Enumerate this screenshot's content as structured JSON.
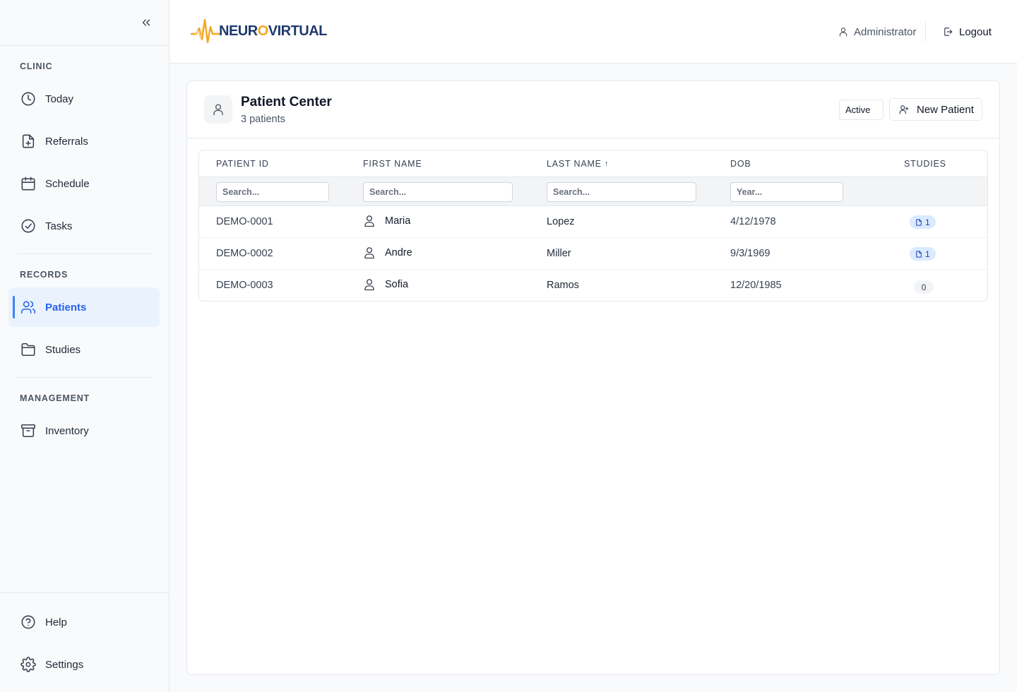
{
  "sidebar": {
    "sections": {
      "clinic": "CLINIC",
      "records": "RECORDS",
      "management": "MANAGEMENT"
    },
    "items": {
      "today": "Today",
      "referrals": "Referrals",
      "schedule": "Schedule",
      "tasks": "Tasks",
      "patients": "Patients",
      "studies": "Studies",
      "inventory": "Inventory",
      "help": "Help",
      "settings": "Settings"
    },
    "active": "Patients"
  },
  "header": {
    "logo_part1": "NEUR",
    "logo_o": "O",
    "logo_part2": "VIRTUAL",
    "user": "Administrator",
    "logout": "Logout"
  },
  "patient_center": {
    "title": "Patient Center",
    "subtitle": "3 patients",
    "status_filter": "Active",
    "new_patient": "New Patient"
  },
  "table": {
    "columns": {
      "patient_id": "PATIENT ID",
      "first_name": "FIRST NAME",
      "last_name": "LAST NAME",
      "last_name_sort": "↑",
      "dob": "DOB",
      "studies": "STUDIES"
    },
    "filters": {
      "patient_id": "Search...",
      "first_name": "Search...",
      "last_name": "Search...",
      "dob": "Year..."
    },
    "rows": [
      {
        "id": "DEMO-0001",
        "first": "Maria",
        "last": "Lopez",
        "dob": "4/12/1978",
        "studies": "1"
      },
      {
        "id": "DEMO-0002",
        "first": "Andre",
        "last": "Miller",
        "dob": "9/3/1969",
        "studies": "1"
      },
      {
        "id": "DEMO-0003",
        "first": "Sofia",
        "last": "Ramos",
        "dob": "12/20/1985",
        "studies": "0"
      }
    ]
  },
  "colors": {
    "accent": "#2563eb",
    "active_bg": "#eaf2fd",
    "logo_navy": "#1e3a6e",
    "logo_orange": "#f5a623"
  }
}
